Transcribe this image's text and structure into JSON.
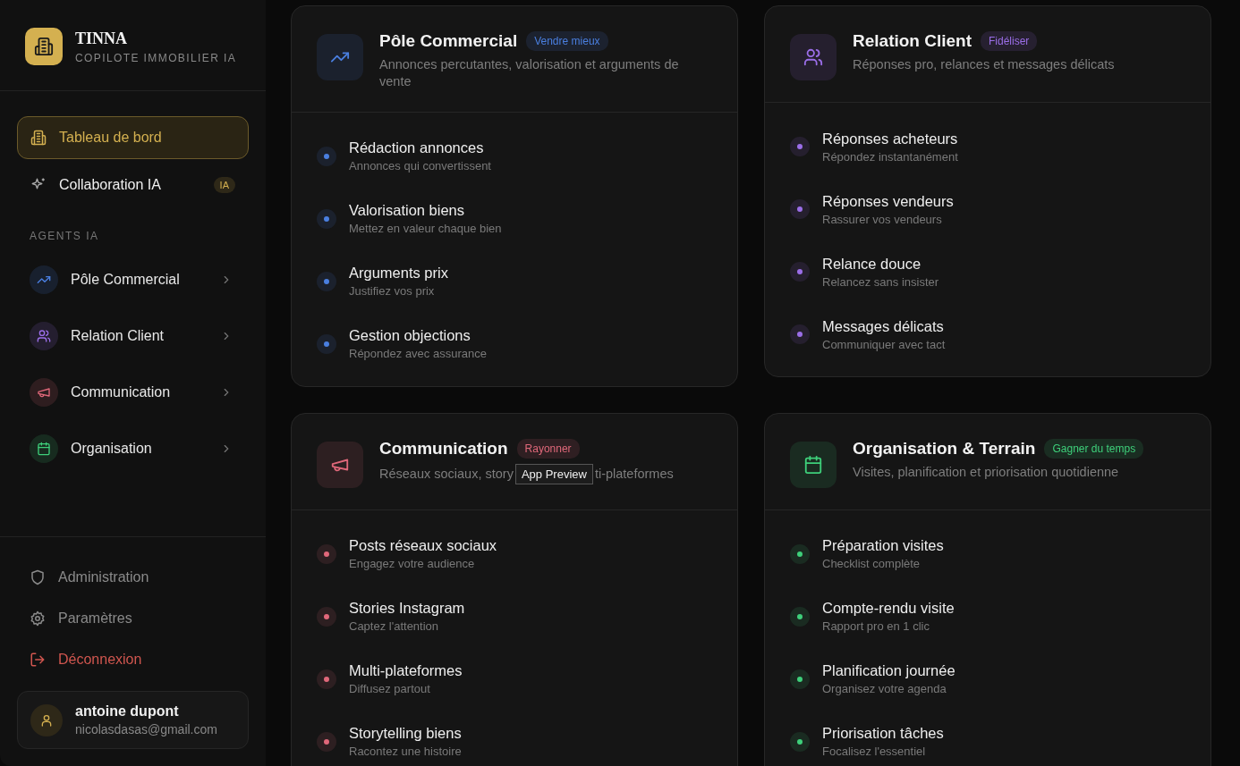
{
  "brand": {
    "name": "TINNA",
    "tagline": "COPILOTE IMMOBILIER IA"
  },
  "nav": [
    {
      "label": "Tableau de bord",
      "kind": "dashboard",
      "selected": true
    },
    {
      "label": "Collaboration IA",
      "kind": "collab",
      "selected": false,
      "badge": "IA"
    }
  ],
  "section_label": "AGENTS IA",
  "agents": [
    {
      "label": "Pôle Commercial",
      "kind": "sales",
      "color": "#4a7fe0"
    },
    {
      "label": "Relation Client",
      "kind": "client",
      "color": "#9b6ee8"
    },
    {
      "label": "Communication",
      "kind": "comms",
      "color": "#e0687a"
    },
    {
      "label": "Organisation",
      "kind": "planning",
      "color": "#3ecf7a"
    }
  ],
  "footer_links": [
    {
      "label": "Administration",
      "kind": "admin"
    },
    {
      "label": "Paramètres",
      "kind": "settings"
    },
    {
      "label": "Déconnexion",
      "kind": "logout"
    }
  ],
  "user": {
    "name": "antoine dupont",
    "email": "nicolasdasas@gmail.com"
  },
  "cards": [
    {
      "title": "Pôle Commercial",
      "badge": "Vendre mieux",
      "kind": "sales",
      "color": "#4a7fe0",
      "description": "Annonces percutantes, valorisation et arguments de vente",
      "items": [
        {
          "title": "Rédaction annonces",
          "subtitle": "Annonces qui convertissent"
        },
        {
          "title": "Valorisation biens",
          "subtitle": "Mettez en valeur chaque bien"
        },
        {
          "title": "Arguments prix",
          "subtitle": "Justifiez vos prix"
        },
        {
          "title": "Gestion objections",
          "subtitle": "Répondez avec assurance"
        }
      ]
    },
    {
      "title": "Relation Client",
      "badge": "Fidéliser",
      "kind": "client",
      "color": "#9b6ee8",
      "description": "Réponses pro, relances et messages délicats",
      "items": [
        {
          "title": "Réponses acheteurs",
          "subtitle": "Répondez instantanément"
        },
        {
          "title": "Réponses vendeurs",
          "subtitle": "Rassurer vos vendeurs"
        },
        {
          "title": "Relance douce",
          "subtitle": "Relancez sans insister"
        },
        {
          "title": "Messages délicats",
          "subtitle": "Communiquer avec tact"
        }
      ]
    },
    {
      "title": "Communication",
      "badge": "Rayonner",
      "kind": "comms",
      "color": "#e0687a",
      "description": "Réseaux sociaux, story",
      "tooltip": "App Preview",
      "description_end": "ti-plateformes",
      "items": [
        {
          "title": "Posts réseaux sociaux",
          "subtitle": "Engagez votre audience"
        },
        {
          "title": "Stories Instagram",
          "subtitle": "Captez l'attention"
        },
        {
          "title": "Multi-plateformes",
          "subtitle": "Diffusez partout"
        },
        {
          "title": "Storytelling biens",
          "subtitle": "Racontez une histoire"
        }
      ]
    },
    {
      "title": "Organisation & Terrain",
      "badge": "Gagner du temps",
      "kind": "planning",
      "color": "#3ecf7a",
      "description": "Visites, planification et priorisation quotidienne",
      "items": [
        {
          "title": "Préparation visites",
          "subtitle": "Checklist complète"
        },
        {
          "title": "Compte-rendu visite",
          "subtitle": "Rapport pro en 1 clic"
        },
        {
          "title": "Planification journée",
          "subtitle": "Organisez votre agenda"
        },
        {
          "title": "Priorisation tâches",
          "subtitle": "Focalisez l'essentiel"
        }
      ]
    }
  ]
}
